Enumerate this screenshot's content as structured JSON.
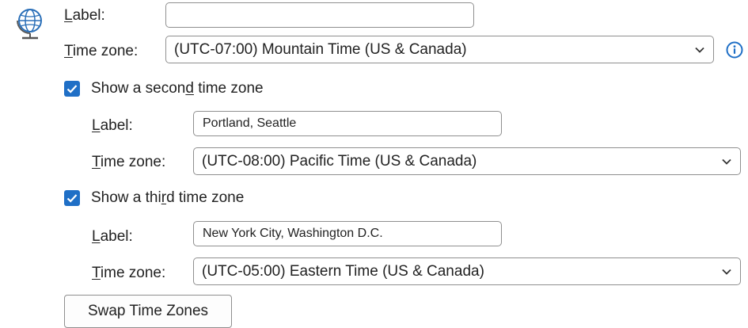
{
  "primary": {
    "label_caption": {
      "ul": "L",
      "rest": "abel:"
    },
    "label_value": "",
    "tz_caption": {
      "ul": "T",
      "rest": "ime zone:"
    },
    "tz_value": "(UTC-07:00) Mountain Time (US & Canada)"
  },
  "second": {
    "checked": true,
    "checkbox_label": {
      "pre": "Show a secon",
      "ul": "d",
      "post": " time zone"
    },
    "label_caption": {
      "ul": "L",
      "rest": "abel:"
    },
    "label_value": "Portland, Seattle",
    "tz_caption": {
      "ul": "T",
      "rest": "ime zone:"
    },
    "tz_value": "(UTC-08:00) Pacific Time (US & Canada)"
  },
  "third": {
    "checked": true,
    "checkbox_label": {
      "pre": "Show a thi",
      "ul": "r",
      "post": "d time zone"
    },
    "label_caption": {
      "ul": "L",
      "rest": "abel:"
    },
    "label_value": "New York City, Washington D.C.",
    "tz_caption": {
      "ul": "T",
      "rest": "ime zone:"
    },
    "tz_value": "(UTC-05:00) Eastern Time (US & Canada)"
  },
  "swap_button": {
    "ul": "S",
    "rest": "wap Time Zones"
  },
  "icons": {
    "globe": "globe-icon",
    "info": "info-icon",
    "chevron": "chevron-down-icon",
    "check": "checkmark-icon"
  },
  "colors": {
    "accent": "#1f6fc6",
    "border": "#8f8f8f",
    "text": "#222222"
  }
}
